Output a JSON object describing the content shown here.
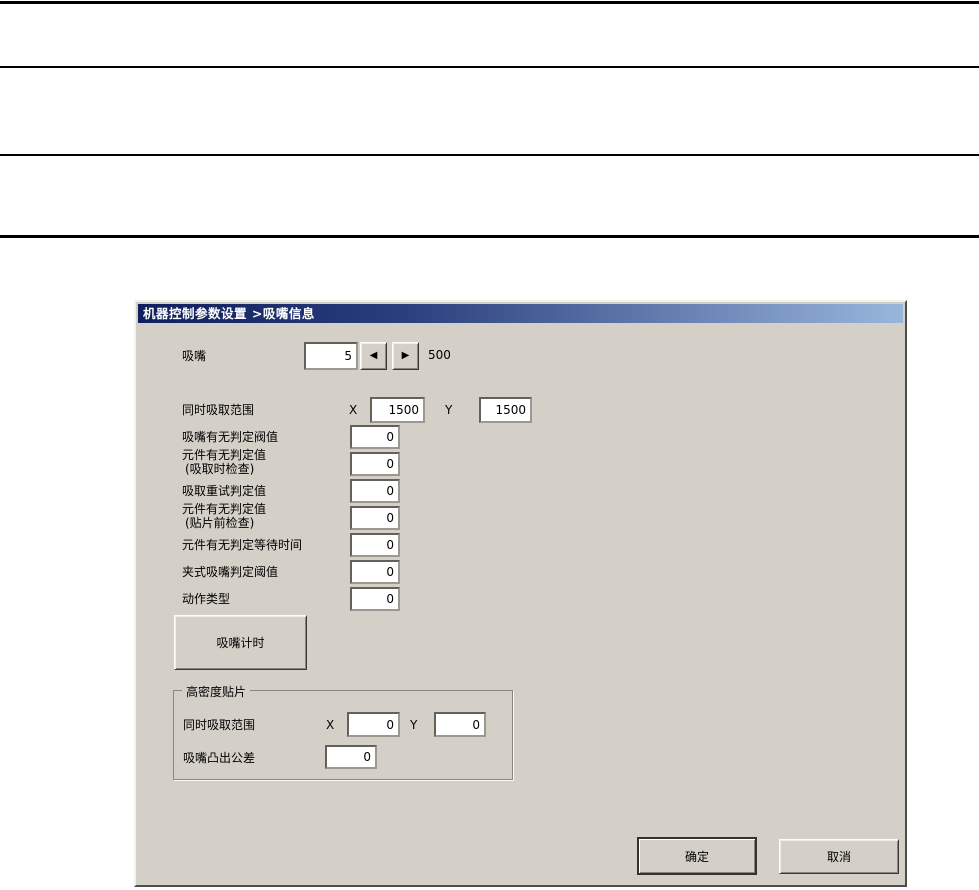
{
  "dialog": {
    "title": "机器控制参数设置 >吸嘴信息",
    "nozzle": {
      "label": "吸嘴",
      "value": "5",
      "max_label": "500"
    },
    "range": {
      "label": "同时吸取范围",
      "x_label": "X",
      "x_value": "1500",
      "y_label": "Y",
      "y_value": "1500"
    },
    "fields": [
      {
        "label": "吸嘴有无判定阀值",
        "value": "0"
      },
      {
        "label": "元件有无判定值",
        "sub": "(吸取时检查)",
        "value": "0"
      },
      {
        "label": "吸取重试判定值",
        "value": "0"
      },
      {
        "label": "元件有无判定值",
        "sub": "(贴片前检查)",
        "value": "0"
      },
      {
        "label": "元件有无判定等待时间",
        "value": "0"
      },
      {
        "label": "夹式吸嘴判定阈值",
        "value": "0"
      },
      {
        "label": "动作类型",
        "value": "0"
      }
    ],
    "timing_button_label": "吸嘴计时",
    "group": {
      "title": "高密度贴片",
      "range": {
        "label": "同时吸取范围",
        "x_label": "X",
        "x_value": "0",
        "y_label": "Y",
        "y_value": "0"
      },
      "tolerance": {
        "label": "吸嘴凸出公差",
        "value": "0"
      }
    },
    "buttons": {
      "ok": "确定",
      "cancel": "取消"
    },
    "icons": {
      "left": "◀",
      "right": "▶"
    }
  },
  "colors": {
    "titlebar_left": "#0f1e5c",
    "titlebar_right": "#98b6dc",
    "dialog_face": "#d4d0c8",
    "rule": "#000000"
  }
}
